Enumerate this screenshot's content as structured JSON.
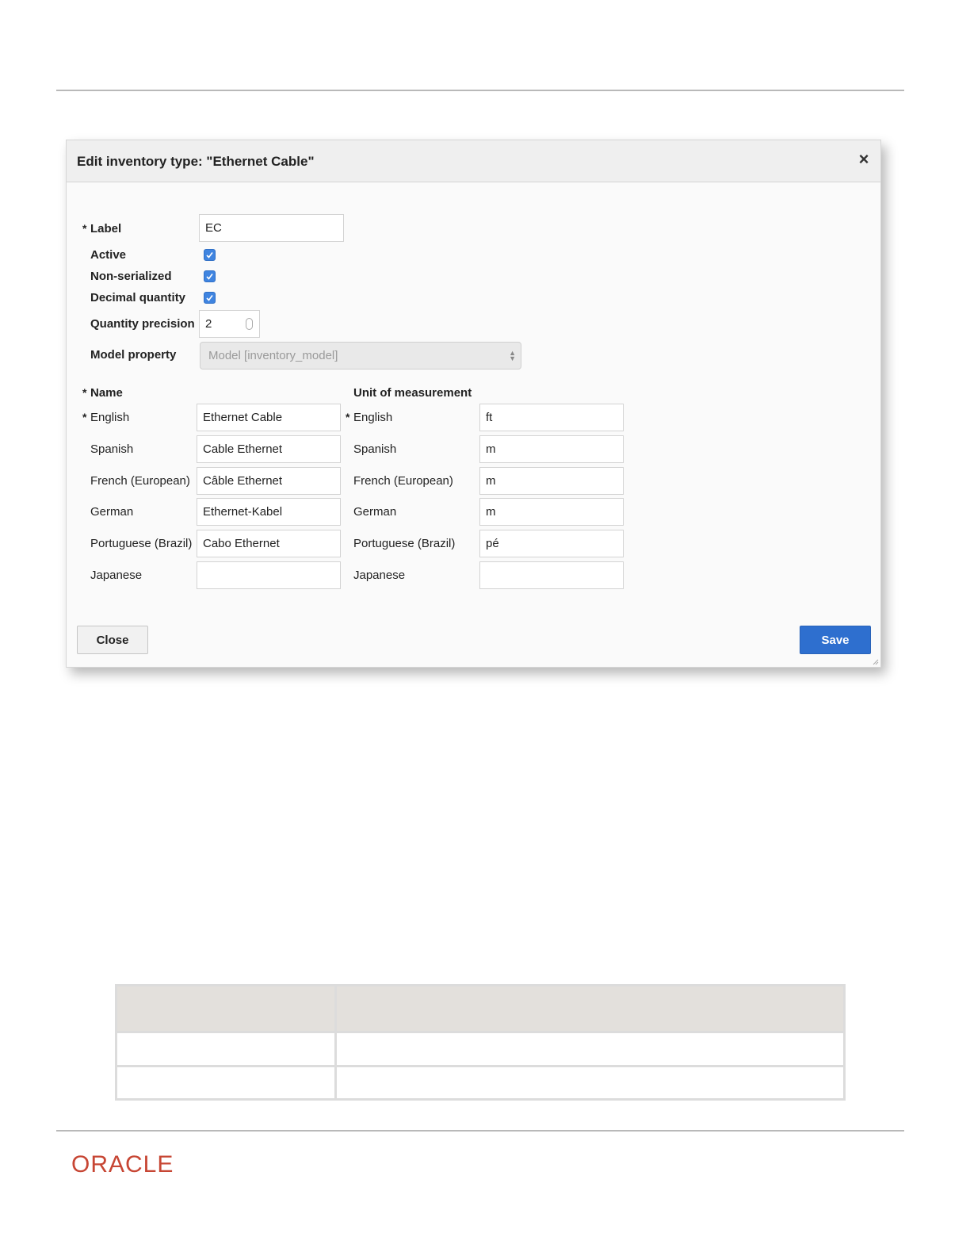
{
  "dialog": {
    "title": "Edit inventory type: \"Ethernet Cable\"",
    "close_icon": "×",
    "required_marker": "*",
    "label": {
      "label": "Label",
      "value": "EC"
    },
    "active": {
      "label": "Active",
      "checked": true
    },
    "non_serialized": {
      "label": "Non-serialized",
      "checked": true
    },
    "decimal_quantity": {
      "label": "Decimal quantity",
      "checked": true
    },
    "quantity_precision": {
      "label": "Quantity precision",
      "value": "2"
    },
    "model_property": {
      "label": "Model property",
      "value": "Model [inventory_model]"
    },
    "name_section": {
      "heading": "Name",
      "rows": [
        {
          "lang": "English",
          "value": "Ethernet Cable"
        },
        {
          "lang": "Spanish",
          "value": "Cable Ethernet"
        },
        {
          "lang": "French (European)",
          "value": "Câble Ethernet"
        },
        {
          "lang": "German",
          "value": "Ethernet-Kabel"
        },
        {
          "lang": "Portuguese (Brazil)",
          "value": "Cabo Ethernet"
        },
        {
          "lang": "Japanese",
          "value": ""
        }
      ]
    },
    "uom_section": {
      "heading": "Unit of measurement",
      "rows": [
        {
          "lang": "English",
          "value": "ft"
        },
        {
          "lang": "Spanish",
          "value": "m"
        },
        {
          "lang": "French (European)",
          "value": "m"
        },
        {
          "lang": "German",
          "value": "m"
        },
        {
          "lang": "Portuguese (Brazil)",
          "value": "pé"
        },
        {
          "lang": "Japanese",
          "value": ""
        }
      ]
    },
    "close_button": "Close",
    "save_button": "Save"
  },
  "footer": {
    "logo": "ORACLE"
  },
  "colors": {
    "primary": "#2e6fcf",
    "checkbox": "#3f84e0",
    "brand": "#c74634"
  }
}
